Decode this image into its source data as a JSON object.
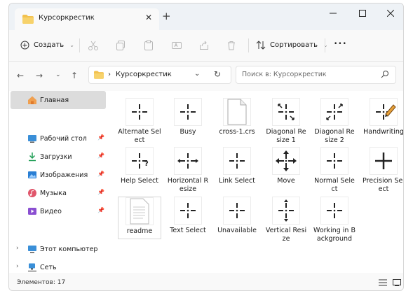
{
  "window": {
    "tab_title": "Курсоркрестик",
    "tab_close": "✕",
    "new_tab": "+"
  },
  "toolbar": {
    "create_label": "Создать",
    "sort_label": "Сортировать",
    "more_label": "•••"
  },
  "address": {
    "path_label": "Курсоркрестик",
    "search_placeholder": "Поиск в: Курсоркрестик"
  },
  "sidebar": {
    "home": "Главная",
    "quick": [
      {
        "label": "Рабочий стол",
        "icon": "desktop-icon"
      },
      {
        "label": "Загрузки",
        "icon": "downloads-icon"
      },
      {
        "label": "Изображения",
        "icon": "pictures-icon"
      },
      {
        "label": "Музыка",
        "icon": "music-icon"
      },
      {
        "label": "Видео",
        "icon": "videos-icon"
      }
    ],
    "this_pc": "Этот компьютер",
    "network": "Сеть"
  },
  "files": [
    {
      "label": "Alternate Select",
      "icon": "cross-cursor-icon"
    },
    {
      "label": "Busy",
      "icon": "cross-cursor-icon"
    },
    {
      "label": "cross-1.crs",
      "icon": "generic-file-icon"
    },
    {
      "label": "Diagonal Resize 1",
      "icon": "diagonal-resize-1-icon"
    },
    {
      "label": "Diagonal Resize 2",
      "icon": "diagonal-resize-2-icon"
    },
    {
      "label": "Handwriting",
      "icon": "handwriting-pencil-icon"
    },
    {
      "label": "Help Select",
      "icon": "help-select-icon"
    },
    {
      "label": "Horizontal Resize",
      "icon": "horizontal-resize-icon"
    },
    {
      "label": "Link Select",
      "icon": "cross-cursor-icon"
    },
    {
      "label": "Move",
      "icon": "move-icon"
    },
    {
      "label": "Normal Select",
      "icon": "cross-cursor-icon"
    },
    {
      "label": "Precision Select",
      "icon": "precision-cross-icon"
    },
    {
      "label": "readme",
      "icon": "text-document-icon"
    },
    {
      "label": "Text Select",
      "icon": "cross-cursor-icon"
    },
    {
      "label": "Unavailable",
      "icon": "cross-cursor-icon"
    },
    {
      "label": "Vertical Resize",
      "icon": "vertical-resize-icon"
    },
    {
      "label": "Working in Background",
      "icon": "cross-cursor-icon"
    }
  ],
  "status": {
    "count_label": "Элементов: 17"
  },
  "colors": {
    "folder": "#f2c14e",
    "accent": "#0067c0"
  }
}
